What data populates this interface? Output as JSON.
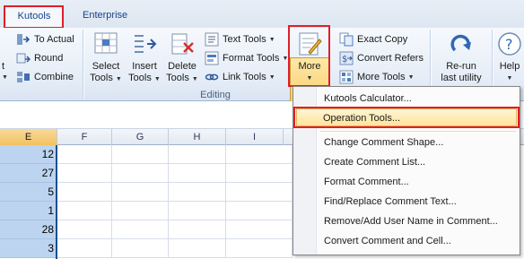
{
  "tabs": {
    "kutools": "Kutools",
    "enterprise": "Enterprise"
  },
  "ribbon": {
    "group1": {
      "to_actual": "To Actual",
      "round": "Round",
      "combine": "Combine",
      "partial_left": "t"
    },
    "editing": {
      "label": "Editing",
      "select_tools": [
        "Select",
        "Tools"
      ],
      "insert_tools": [
        "Insert",
        "Tools"
      ],
      "delete_tools": [
        "Delete",
        "Tools"
      ],
      "text_tools": "Text Tools",
      "format_tools": "Format Tools",
      "link_tools": "Link Tools",
      "more": "More",
      "exact_copy": "Exact Copy",
      "convert_refers": "Convert Refers",
      "more_tools": "More Tools"
    },
    "rerun": [
      "Re-run",
      "last utility"
    ],
    "help": "Help"
  },
  "sheet": {
    "columns": [
      "E",
      "F",
      "G",
      "H",
      "I"
    ],
    "selected_column": "E",
    "column_e_values": [
      "12",
      "27",
      "5",
      "1",
      "28",
      "3"
    ]
  },
  "menu": {
    "items": [
      "Kutools Calculator...",
      "Operation Tools...",
      "Change Comment Shape...",
      "Create Comment List...",
      "Format Comment...",
      "Find/Replace Comment Text...",
      "Remove/Add User Name in Comment...",
      "Convert Comment and Cell..."
    ],
    "highlighted_index": 1
  },
  "colors": {
    "highlight_red": "#e01e2b",
    "selection_blue": "#bcd4f0",
    "hover_gold": "#ffe49a"
  }
}
